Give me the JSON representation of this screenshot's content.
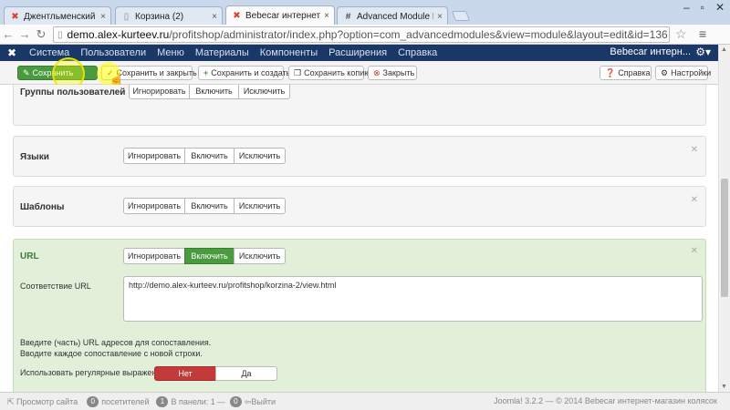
{
  "browser": {
    "tabs": [
      {
        "title": "Джентльменский набор",
        "icon": "joomla-icon"
      },
      {
        "title": "Корзина (2)",
        "icon": "page-icon"
      },
      {
        "title": "Bebecar интернет-магазин",
        "icon": "joomla-icon"
      },
      {
        "title": "Advanced Module Manag",
        "icon": "hash-icon"
      }
    ],
    "url_domain": "demo.alex-kurteev.ru",
    "url_path": "/profitshop/administrator/index.php?option=com_advancedmodules&view=module&layout=edit&id=136"
  },
  "navbar": {
    "menu": [
      "Система",
      "Пользователи",
      "Меню",
      "Материалы",
      "Компоненты",
      "Расширения",
      "Справка"
    ],
    "site_name": "Bebecar интерн..."
  },
  "toolbar": {
    "save": "Сохранить",
    "save_close": "Сохранить и закрыть",
    "save_new": "Сохранить и создать",
    "save_copy": "Сохранить копию",
    "close": "Закрыть",
    "help": "Справка",
    "settings": "Настройки"
  },
  "panels": {
    "usergroups": {
      "label": "Группы пользователей",
      "options": [
        "Игнорировать",
        "Включить",
        "Исключить"
      ]
    },
    "languages": {
      "label": "Языки",
      "options": [
        "Игнорировать",
        "Включить",
        "Исключить"
      ]
    },
    "templates": {
      "label": "Шаблоны",
      "options": [
        "Игнорировать",
        "Включить",
        "Исключить"
      ]
    },
    "url": {
      "label": "URL",
      "options": [
        "Игнорировать",
        "Включить",
        "Исключить"
      ],
      "selected": "Включить",
      "match_label": "Соответствие URL",
      "match_value": "http://demo.alex-kurteev.ru/profitshop/korzina-2/view.html",
      "help_line1": "Введите (часть) URL адресов для сопоставления.",
      "help_line2": "Вводите каждое сопоставление с новой строки.",
      "regex_label": "Использовать регулярные выражения",
      "regex_no": "Нет",
      "regex_yes": "Да"
    }
  },
  "statusbar": {
    "preview": "Просмотр сайта",
    "visitors_count": "0",
    "visitors_label": "посетителей",
    "panel_count": "1",
    "panel_label": "В панели: 1",
    "logout_count": "0",
    "logout_label": "Выйти",
    "footer": "Joomla! 3.2.2 — © 2014 Bebecar интернет-магазин колясок"
  }
}
